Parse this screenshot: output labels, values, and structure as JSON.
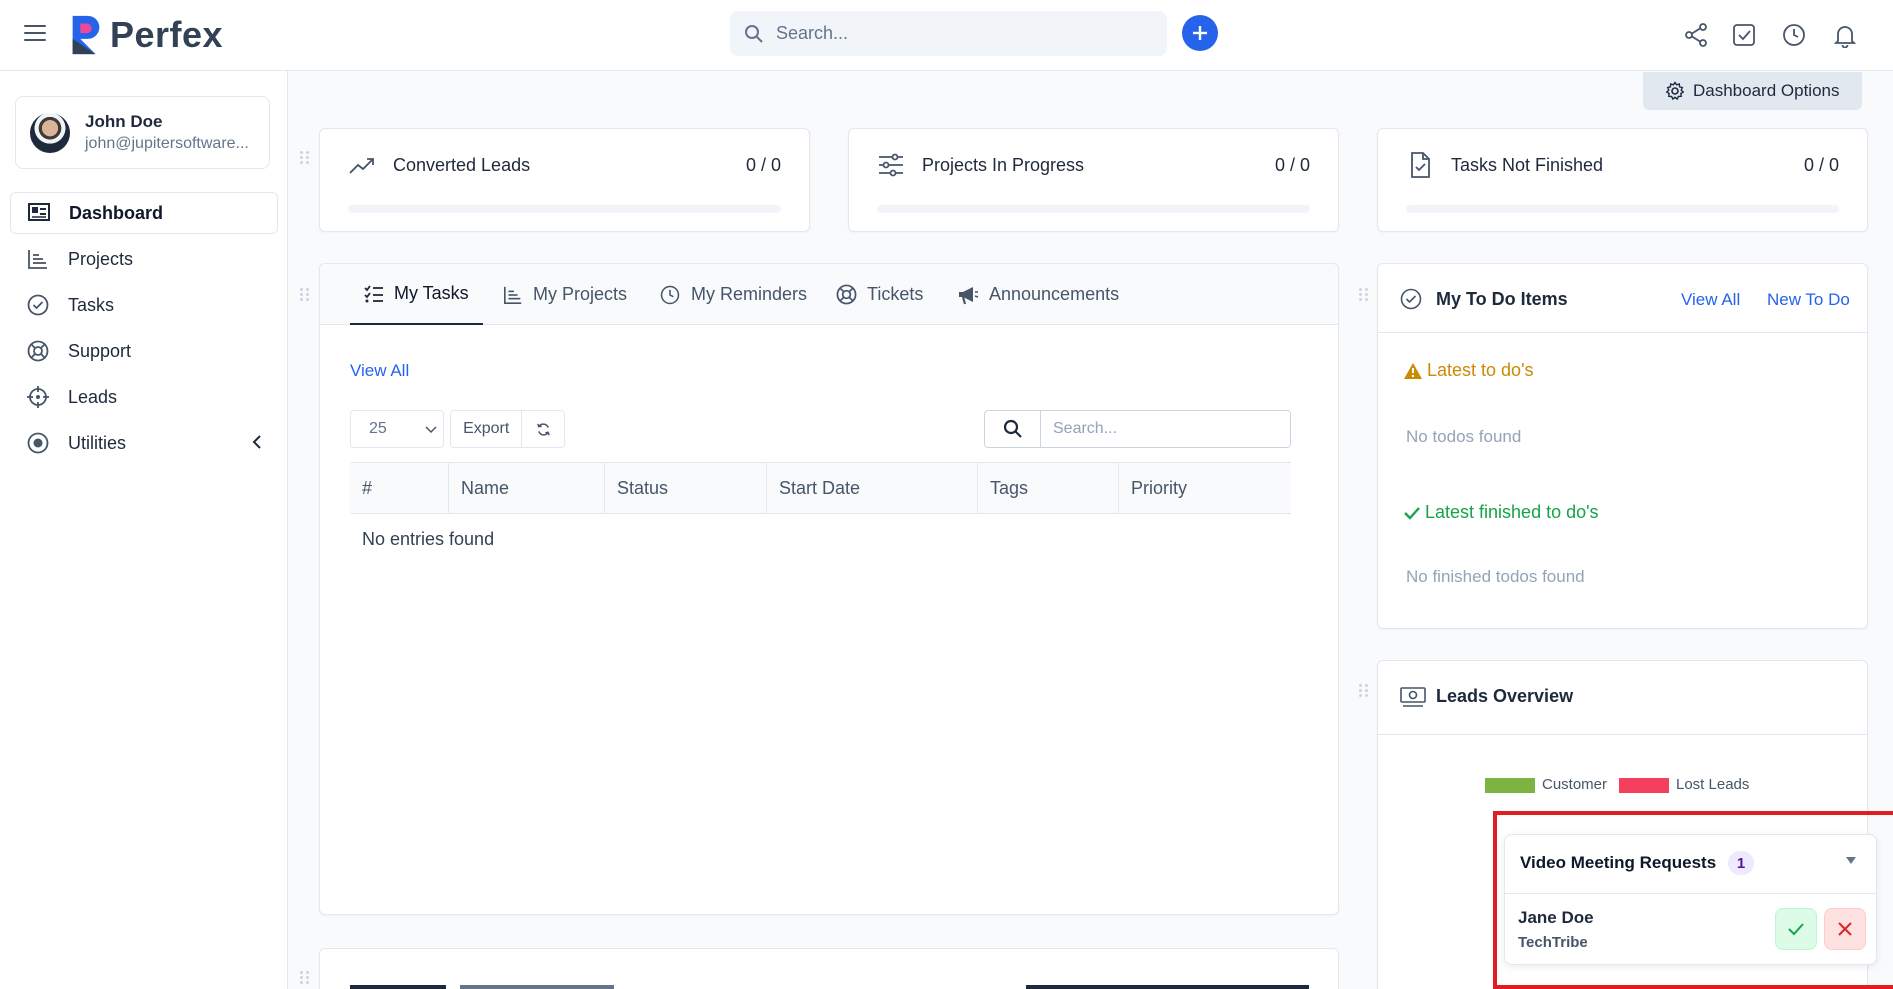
{
  "header": {
    "logo_text": "Perfex",
    "search_placeholder": "Search..."
  },
  "sidebar": {
    "profile": {
      "name": "John Doe",
      "email": "john@jupitersoftware..."
    },
    "items": [
      {
        "label": "Dashboard",
        "icon": "dashboard-icon",
        "active": true
      },
      {
        "label": "Projects",
        "icon": "chart-bars-icon"
      },
      {
        "label": "Tasks",
        "icon": "check-circle-icon"
      },
      {
        "label": "Support",
        "icon": "lifebuoy-icon"
      },
      {
        "label": "Leads",
        "icon": "crosshair-icon"
      },
      {
        "label": "Utilities",
        "icon": "radio-dot-icon"
      }
    ]
  },
  "dashboard_options_label": "Dashboard Options",
  "stats": [
    {
      "title": "Converted Leads",
      "value": "0 / 0",
      "icon": "trend-up-icon"
    },
    {
      "title": "Projects In Progress",
      "value": "0 / 0",
      "icon": "sliders-icon"
    },
    {
      "title": "Tasks Not Finished",
      "value": "0 / 0",
      "icon": "file-check-icon"
    }
  ],
  "tabs": [
    {
      "label": "My Tasks",
      "active": true
    },
    {
      "label": "My Projects"
    },
    {
      "label": "My Reminders"
    },
    {
      "label": "Tickets"
    },
    {
      "label": "Announcements"
    }
  ],
  "tasks_table": {
    "view_all": "View All",
    "page_size": "25",
    "export_label": "Export",
    "search_placeholder": "Search...",
    "columns": [
      "#",
      "Name",
      "Status",
      "Start Date",
      "Tags",
      "Priority"
    ],
    "empty_text": "No entries found"
  },
  "todo": {
    "title": "My To Do Items",
    "view_all": "View All",
    "new_todo": "New To Do",
    "latest_title": "Latest to do's",
    "latest_empty": "No todos found",
    "finished_title": "Latest finished to do's",
    "finished_empty": "No finished todos found"
  },
  "leads_overview": {
    "title": "Leads Overview",
    "legend": [
      {
        "label": "Customer",
        "color": "#7cb342"
      },
      {
        "label": "Lost Leads",
        "color": "#f43f5e"
      }
    ]
  },
  "video_meetings": {
    "title": "Video Meeting Requests",
    "count": "1",
    "requests": [
      {
        "name": "Jane Doe",
        "company": "TechTribe"
      }
    ]
  },
  "colors": {
    "accent": "#2563eb",
    "highlight_frame": "#e11d22"
  }
}
